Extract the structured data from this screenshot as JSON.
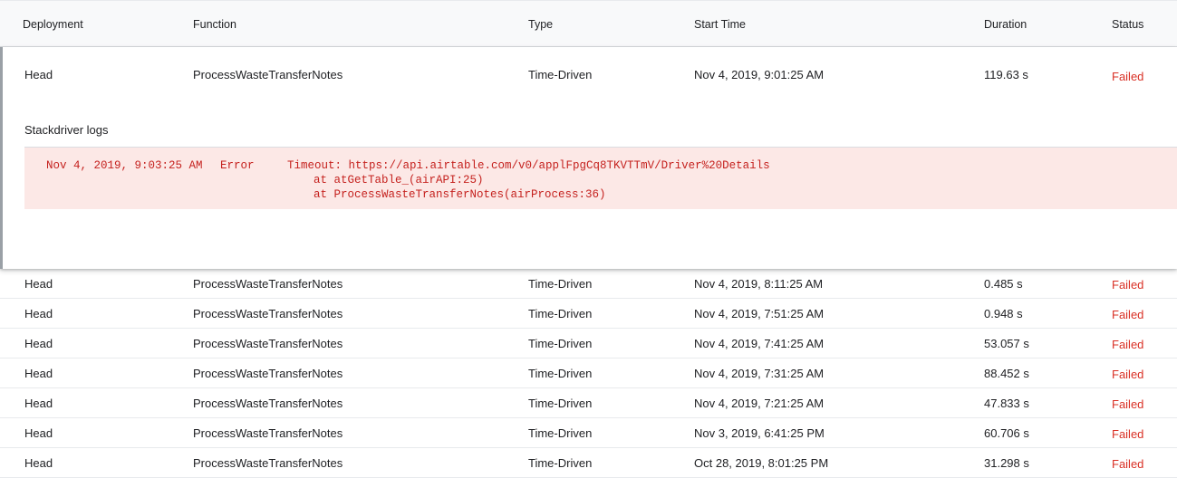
{
  "columns": {
    "deployment": "Deployment",
    "function": "Function",
    "type": "Type",
    "start_time": "Start Time",
    "duration": "Duration",
    "status": "Status"
  },
  "expanded": {
    "deployment": "Head",
    "function": "ProcessWasteTransferNotes",
    "type": "Time-Driven",
    "start_time": "Nov 4, 2019, 9:01:25 AM",
    "duration": "119.63 s",
    "status": "Failed",
    "logs_title": "Stackdriver logs",
    "log": {
      "timestamp": "Nov 4, 2019, 9:03:25 AM",
      "severity": "Error",
      "line1": "Timeout: https://api.airtable.com/v0/applFpgCq8TKVTTmV/Driver%20Details",
      "line2": "at atGetTable_(airAPI:25)",
      "line3": "at ProcessWasteTransferNotes(airProcess:36)"
    }
  },
  "rows": [
    {
      "deployment": "Head",
      "function": "ProcessWasteTransferNotes",
      "type": "Time-Driven",
      "start_time": "Nov 4, 2019, 8:11:25 AM",
      "duration": "0.485 s",
      "status": "Failed"
    },
    {
      "deployment": "Head",
      "function": "ProcessWasteTransferNotes",
      "type": "Time-Driven",
      "start_time": "Nov 4, 2019, 7:51:25 AM",
      "duration": "0.948 s",
      "status": "Failed"
    },
    {
      "deployment": "Head",
      "function": "ProcessWasteTransferNotes",
      "type": "Time-Driven",
      "start_time": "Nov 4, 2019, 7:41:25 AM",
      "duration": "53.057 s",
      "status": "Failed"
    },
    {
      "deployment": "Head",
      "function": "ProcessWasteTransferNotes",
      "type": "Time-Driven",
      "start_time": "Nov 4, 2019, 7:31:25 AM",
      "duration": "88.452 s",
      "status": "Failed"
    },
    {
      "deployment": "Head",
      "function": "ProcessWasteTransferNotes",
      "type": "Time-Driven",
      "start_time": "Nov 4, 2019, 7:21:25 AM",
      "duration": "47.833 s",
      "status": "Failed"
    },
    {
      "deployment": "Head",
      "function": "ProcessWasteTransferNotes",
      "type": "Time-Driven",
      "start_time": "Nov 3, 2019, 6:41:25 PM",
      "duration": "60.706 s",
      "status": "Failed"
    },
    {
      "deployment": "Head",
      "function": "ProcessWasteTransferNotes",
      "type": "Time-Driven",
      "start_time": "Oct 28, 2019, 8:01:25 PM",
      "duration": "31.298 s",
      "status": "Failed"
    }
  ],
  "colors": {
    "failed": "#d93025",
    "log_background": "#fce8e6",
    "log_text": "#c5221f"
  }
}
